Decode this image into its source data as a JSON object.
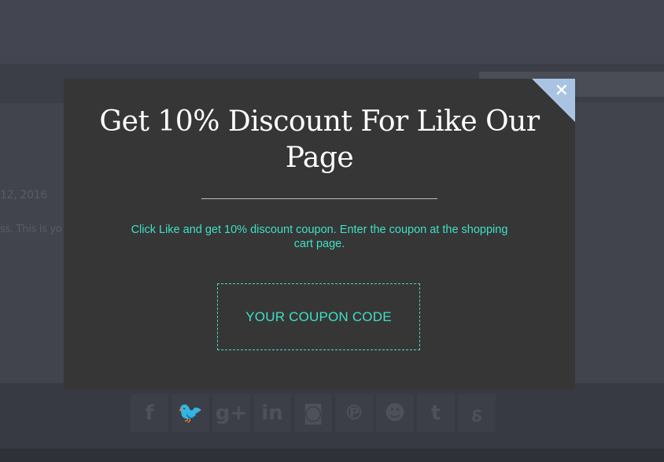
{
  "background": {
    "date_text": "12, 2016",
    "excerpt_text": "ss. This is yo",
    "social_icons": [
      {
        "name": "facebook-icon",
        "glyph": "f"
      },
      {
        "name": "twitter-icon",
        "glyph": "🐦"
      },
      {
        "name": "google-plus-icon",
        "glyph": "g+"
      },
      {
        "name": "linkedin-icon",
        "glyph": "in"
      },
      {
        "name": "instagram-icon",
        "glyph": "◙"
      },
      {
        "name": "pinterest-icon",
        "glyph": "℗"
      },
      {
        "name": "reddit-icon",
        "glyph": "☻"
      },
      {
        "name": "tumblr-icon",
        "glyph": "t"
      },
      {
        "name": "stumbleupon-icon",
        "glyph": "ꟙ"
      }
    ]
  },
  "modal": {
    "close_label": "✕",
    "title": "Get 10% Discount For Like Our Page",
    "description": "Click Like and get 10% discount coupon. Enter the coupon at the shopping cart page.",
    "coupon_label": "YOUR COUPON CODE"
  },
  "colors": {
    "accent": "#3fe0c5",
    "modal_bg": "#363636",
    "close_corner": "#a9c4e2"
  }
}
